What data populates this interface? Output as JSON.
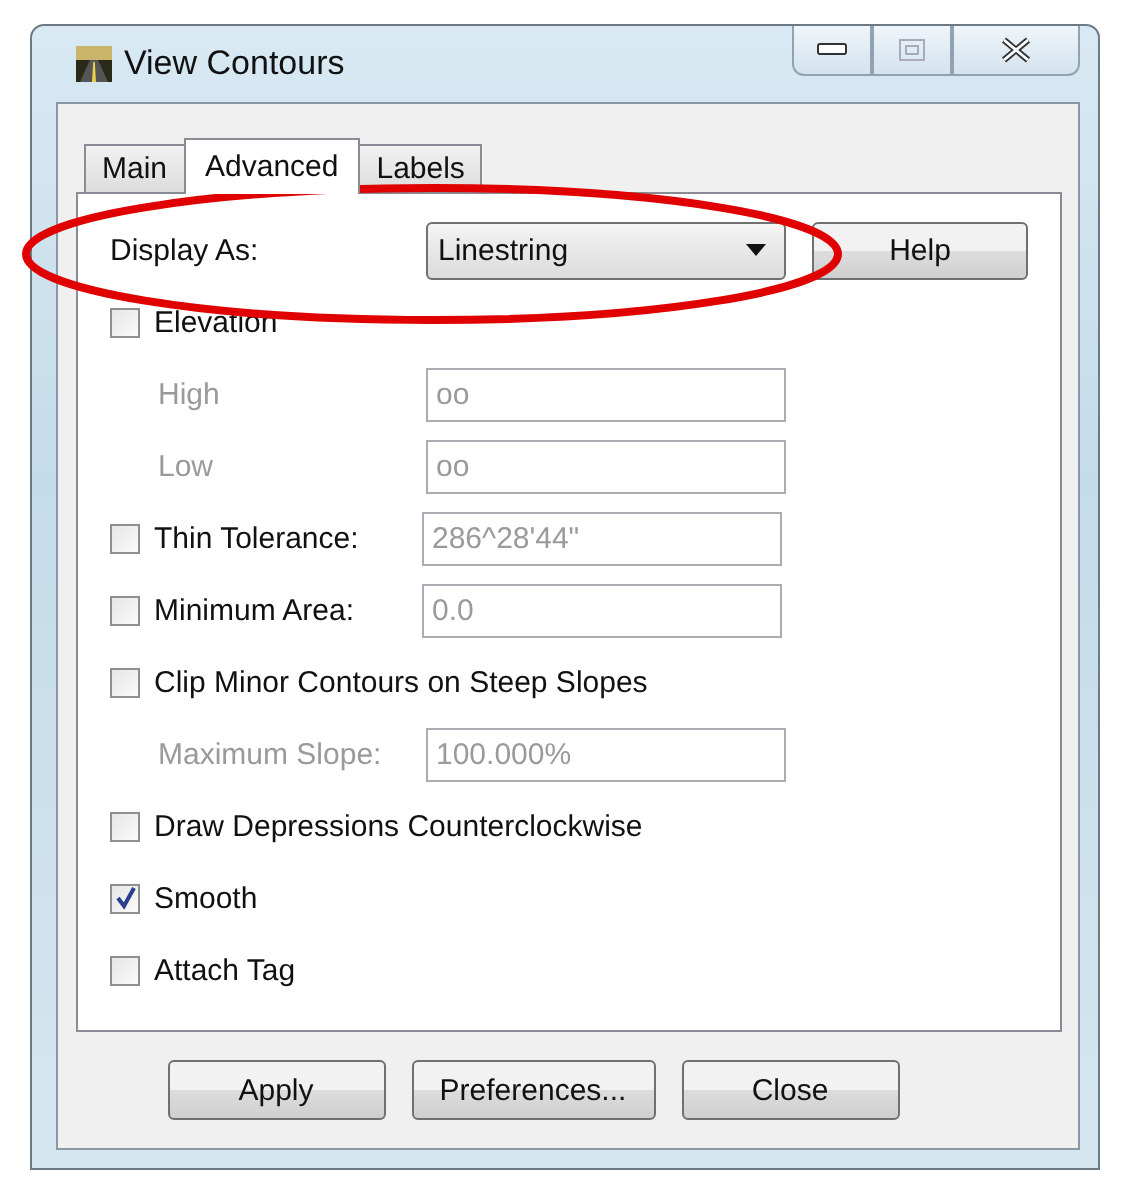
{
  "window": {
    "title": "View Contours"
  },
  "tabs": [
    {
      "label": "Main",
      "selected": false
    },
    {
      "label": "Advanced",
      "selected": true
    },
    {
      "label": "Labels",
      "selected": false
    }
  ],
  "options": [
    {
      "kind": "select",
      "label": "Display As:",
      "value": "Linestring",
      "button": "Help"
    },
    {
      "kind": "checkbox",
      "label": "Elevation",
      "checked": false
    },
    {
      "kind": "field",
      "label": "High",
      "value": "oo",
      "disabled": true
    },
    {
      "kind": "field",
      "label": "Low",
      "value": "oo",
      "disabled": true
    },
    {
      "kind": "checkbox_field",
      "label": "Thin Tolerance:",
      "checked": false,
      "value": "286^28'44\"",
      "disabled": true
    },
    {
      "kind": "checkbox_field",
      "label": "Minimum Area:",
      "checked": false,
      "value": "0.0",
      "disabled": true
    },
    {
      "kind": "checkbox",
      "label": "Clip Minor Contours on Steep Slopes",
      "checked": false
    },
    {
      "kind": "field",
      "label": "Maximum Slope:",
      "value": "100.000%",
      "disabled": true
    },
    {
      "kind": "checkbox",
      "label": "Draw Depressions Counterclockwise",
      "checked": false
    },
    {
      "kind": "checkbox",
      "label": "Smooth",
      "checked": true
    },
    {
      "kind": "checkbox",
      "label": "Attach Tag",
      "checked": false
    }
  ],
  "buttons": [
    "Apply",
    "Preferences...",
    "Close"
  ]
}
